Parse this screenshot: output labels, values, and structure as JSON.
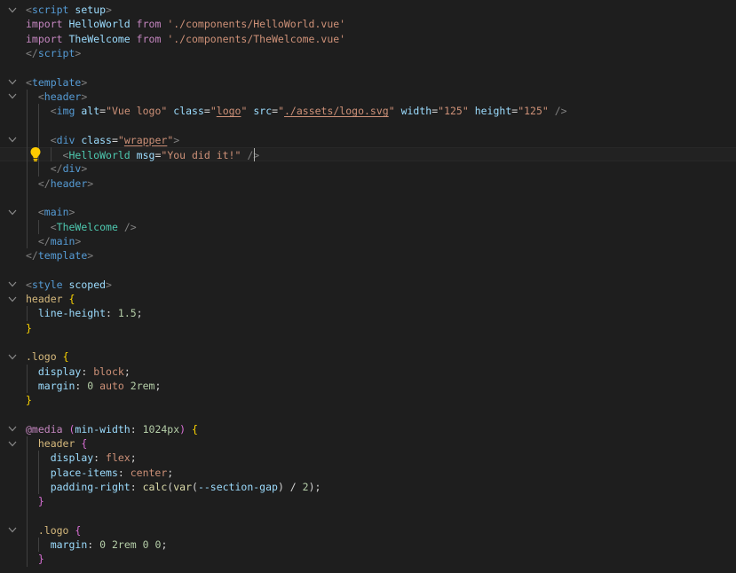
{
  "editor": {
    "language": "vue",
    "theme_colors": {
      "background": "#1e1e1e",
      "tag": "#569cd6",
      "attribute": "#9cdcfe",
      "string": "#ce9178",
      "keyword": "#c586c0",
      "component": "#4ec9b0",
      "selector": "#d7ba7d",
      "number": "#b5cea8",
      "function": "#dcdcaa"
    },
    "lines": [
      [
        [
          "t-br",
          "<"
        ],
        [
          "t-tag",
          "script"
        ],
        [
          "t-text",
          " "
        ],
        [
          "t-attr",
          "setup"
        ],
        [
          "t-br",
          ">"
        ]
      ],
      [
        [
          "t-kw",
          "import"
        ],
        [
          "t-text",
          " "
        ],
        [
          "t-attr",
          "HelloWorld"
        ],
        [
          "t-text",
          " "
        ],
        [
          "t-kw",
          "from"
        ],
        [
          "t-text",
          " "
        ],
        [
          "t-str",
          "'./components/HelloWorld.vue'"
        ]
      ],
      [
        [
          "t-kw",
          "import"
        ],
        [
          "t-text",
          " "
        ],
        [
          "t-attr",
          "TheWelcome"
        ],
        [
          "t-text",
          " "
        ],
        [
          "t-kw",
          "from"
        ],
        [
          "t-text",
          " "
        ],
        [
          "t-str",
          "'./components/TheWelcome.vue'"
        ]
      ],
      [
        [
          "t-br",
          "</"
        ],
        [
          "t-tag",
          "script"
        ],
        [
          "t-br",
          ">"
        ]
      ],
      [],
      [
        [
          "t-br",
          "<"
        ],
        [
          "t-tag",
          "template"
        ],
        [
          "t-br",
          ">"
        ]
      ],
      [
        [
          "t-text",
          "  "
        ],
        [
          "t-br",
          "<"
        ],
        [
          "t-tag",
          "header"
        ],
        [
          "t-br",
          ">"
        ]
      ],
      [
        [
          "t-text",
          "    "
        ],
        [
          "t-br",
          "<"
        ],
        [
          "t-tag",
          "img"
        ],
        [
          "t-text",
          " "
        ],
        [
          "t-attr",
          "alt"
        ],
        [
          "t-text",
          "="
        ],
        [
          "t-str",
          "\"Vue logo\""
        ],
        [
          "t-text",
          " "
        ],
        [
          "t-attr",
          "class"
        ],
        [
          "t-text",
          "="
        ],
        [
          "t-str",
          "\""
        ],
        [
          "t-str t-u",
          "logo"
        ],
        [
          "t-str",
          "\""
        ],
        [
          "t-text",
          " "
        ],
        [
          "t-attr",
          "src"
        ],
        [
          "t-text",
          "="
        ],
        [
          "t-str",
          "\""
        ],
        [
          "t-str t-u",
          "./assets/logo.svg"
        ],
        [
          "t-str",
          "\""
        ],
        [
          "t-text",
          " "
        ],
        [
          "t-attr",
          "width"
        ],
        [
          "t-text",
          "="
        ],
        [
          "t-str",
          "\"125\""
        ],
        [
          "t-text",
          " "
        ],
        [
          "t-attr",
          "height"
        ],
        [
          "t-text",
          "="
        ],
        [
          "t-str",
          "\"125\""
        ],
        [
          "t-text",
          " "
        ],
        [
          "t-br",
          "/>"
        ]
      ],
      [],
      [
        [
          "t-text",
          "    "
        ],
        [
          "t-br",
          "<"
        ],
        [
          "t-tag",
          "div"
        ],
        [
          "t-text",
          " "
        ],
        [
          "t-attr",
          "class"
        ],
        [
          "t-text",
          "="
        ],
        [
          "t-str",
          "\""
        ],
        [
          "t-str t-u",
          "wrapper"
        ],
        [
          "t-str",
          "\""
        ],
        [
          "t-br",
          ">"
        ]
      ],
      [
        [
          "t-text",
          "      "
        ],
        [
          "t-br",
          "<"
        ],
        [
          "t-comp",
          "HelloWorld"
        ],
        [
          "t-text",
          " "
        ],
        [
          "t-attr",
          "msg"
        ],
        [
          "t-text",
          "="
        ],
        [
          "t-str",
          "\"You did it!\""
        ],
        [
          "t-text",
          " "
        ],
        [
          "t-br",
          "/>"
        ]
      ],
      [
        [
          "t-text",
          "    "
        ],
        [
          "t-br",
          "</"
        ],
        [
          "t-tag",
          "div"
        ],
        [
          "t-br",
          ">"
        ]
      ],
      [
        [
          "t-text",
          "  "
        ],
        [
          "t-br",
          "</"
        ],
        [
          "t-tag",
          "header"
        ],
        [
          "t-br",
          ">"
        ]
      ],
      [],
      [
        [
          "t-text",
          "  "
        ],
        [
          "t-br",
          "<"
        ],
        [
          "t-tag",
          "main"
        ],
        [
          "t-br",
          ">"
        ]
      ],
      [
        [
          "t-text",
          "    "
        ],
        [
          "t-br",
          "<"
        ],
        [
          "t-comp",
          "TheWelcome"
        ],
        [
          "t-text",
          " "
        ],
        [
          "t-br",
          "/>"
        ]
      ],
      [
        [
          "t-text",
          "  "
        ],
        [
          "t-br",
          "</"
        ],
        [
          "t-tag",
          "main"
        ],
        [
          "t-br",
          ">"
        ]
      ],
      [
        [
          "t-br",
          "</"
        ],
        [
          "t-tag",
          "template"
        ],
        [
          "t-br",
          ">"
        ]
      ],
      [],
      [
        [
          "t-br",
          "<"
        ],
        [
          "t-tag",
          "style"
        ],
        [
          "t-text",
          " "
        ],
        [
          "t-attr",
          "scoped"
        ],
        [
          "t-br",
          ">"
        ]
      ],
      [
        [
          "t-sel",
          "header"
        ],
        [
          "t-text",
          " "
        ],
        [
          "t-b1",
          "{"
        ]
      ],
      [
        [
          "t-text",
          "  "
        ],
        [
          "t-prop",
          "line-height"
        ],
        [
          "t-text",
          ": "
        ],
        [
          "t-num",
          "1.5"
        ],
        [
          "t-text",
          ";"
        ]
      ],
      [
        [
          "t-b1",
          "}"
        ]
      ],
      [],
      [
        [
          "t-sel",
          ".logo"
        ],
        [
          "t-text",
          " "
        ],
        [
          "t-b1",
          "{"
        ]
      ],
      [
        [
          "t-text",
          "  "
        ],
        [
          "t-prop",
          "display"
        ],
        [
          "t-text",
          ": "
        ],
        [
          "t-str",
          "block"
        ],
        [
          "t-text",
          ";"
        ]
      ],
      [
        [
          "t-text",
          "  "
        ],
        [
          "t-prop",
          "margin"
        ],
        [
          "t-text",
          ": "
        ],
        [
          "t-num",
          "0"
        ],
        [
          "t-text",
          " "
        ],
        [
          "t-str",
          "auto"
        ],
        [
          "t-text",
          " "
        ],
        [
          "t-num",
          "2rem"
        ],
        [
          "t-text",
          ";"
        ]
      ],
      [
        [
          "t-b1",
          "}"
        ]
      ],
      [],
      [
        [
          "t-at",
          "@media"
        ],
        [
          "t-text",
          " "
        ],
        [
          "t-b2",
          "("
        ],
        [
          "t-prop",
          "min-width"
        ],
        [
          "t-text",
          ": "
        ],
        [
          "t-num",
          "1024px"
        ],
        [
          "t-b2",
          ")"
        ],
        [
          "t-text",
          " "
        ],
        [
          "t-b1",
          "{"
        ]
      ],
      [
        [
          "t-text",
          "  "
        ],
        [
          "t-sel",
          "header"
        ],
        [
          "t-text",
          " "
        ],
        [
          "t-b2",
          "{"
        ]
      ],
      [
        [
          "t-text",
          "    "
        ],
        [
          "t-prop",
          "display"
        ],
        [
          "t-text",
          ": "
        ],
        [
          "t-str",
          "flex"
        ],
        [
          "t-text",
          ";"
        ]
      ],
      [
        [
          "t-text",
          "    "
        ],
        [
          "t-prop",
          "place-items"
        ],
        [
          "t-text",
          ": "
        ],
        [
          "t-str",
          "center"
        ],
        [
          "t-text",
          ";"
        ]
      ],
      [
        [
          "t-text",
          "    "
        ],
        [
          "t-prop",
          "padding-right"
        ],
        [
          "t-text",
          ": "
        ],
        [
          "t-fn",
          "calc"
        ],
        [
          "t-text",
          "("
        ],
        [
          "t-fn",
          "var"
        ],
        [
          "t-text",
          "("
        ],
        [
          "t-attr",
          "--section-gap"
        ],
        [
          "t-text",
          ") / "
        ],
        [
          "t-num",
          "2"
        ],
        [
          "t-text",
          ");"
        ]
      ],
      [
        [
          "t-text",
          "  "
        ],
        [
          "t-b2",
          "}"
        ]
      ],
      [],
      [
        [
          "t-text",
          "  "
        ],
        [
          "t-sel",
          ".logo"
        ],
        [
          "t-text",
          " "
        ],
        [
          "t-b2",
          "{"
        ]
      ],
      [
        [
          "t-text",
          "    "
        ],
        [
          "t-prop",
          "margin"
        ],
        [
          "t-text",
          ": "
        ],
        [
          "t-num",
          "0"
        ],
        [
          "t-text",
          " "
        ],
        [
          "t-num",
          "2rem"
        ],
        [
          "t-text",
          " "
        ],
        [
          "t-num",
          "0"
        ],
        [
          "t-text",
          " "
        ],
        [
          "t-num",
          "0"
        ],
        [
          "t-text",
          ";"
        ]
      ],
      [
        [
          "t-text",
          "  "
        ],
        [
          "t-b2",
          "}"
        ]
      ]
    ],
    "fold_lines": [
      0,
      5,
      6,
      9,
      14,
      19,
      20,
      24,
      29,
      30,
      36
    ],
    "active_line": 10,
    "lightbulb_line": 10
  }
}
